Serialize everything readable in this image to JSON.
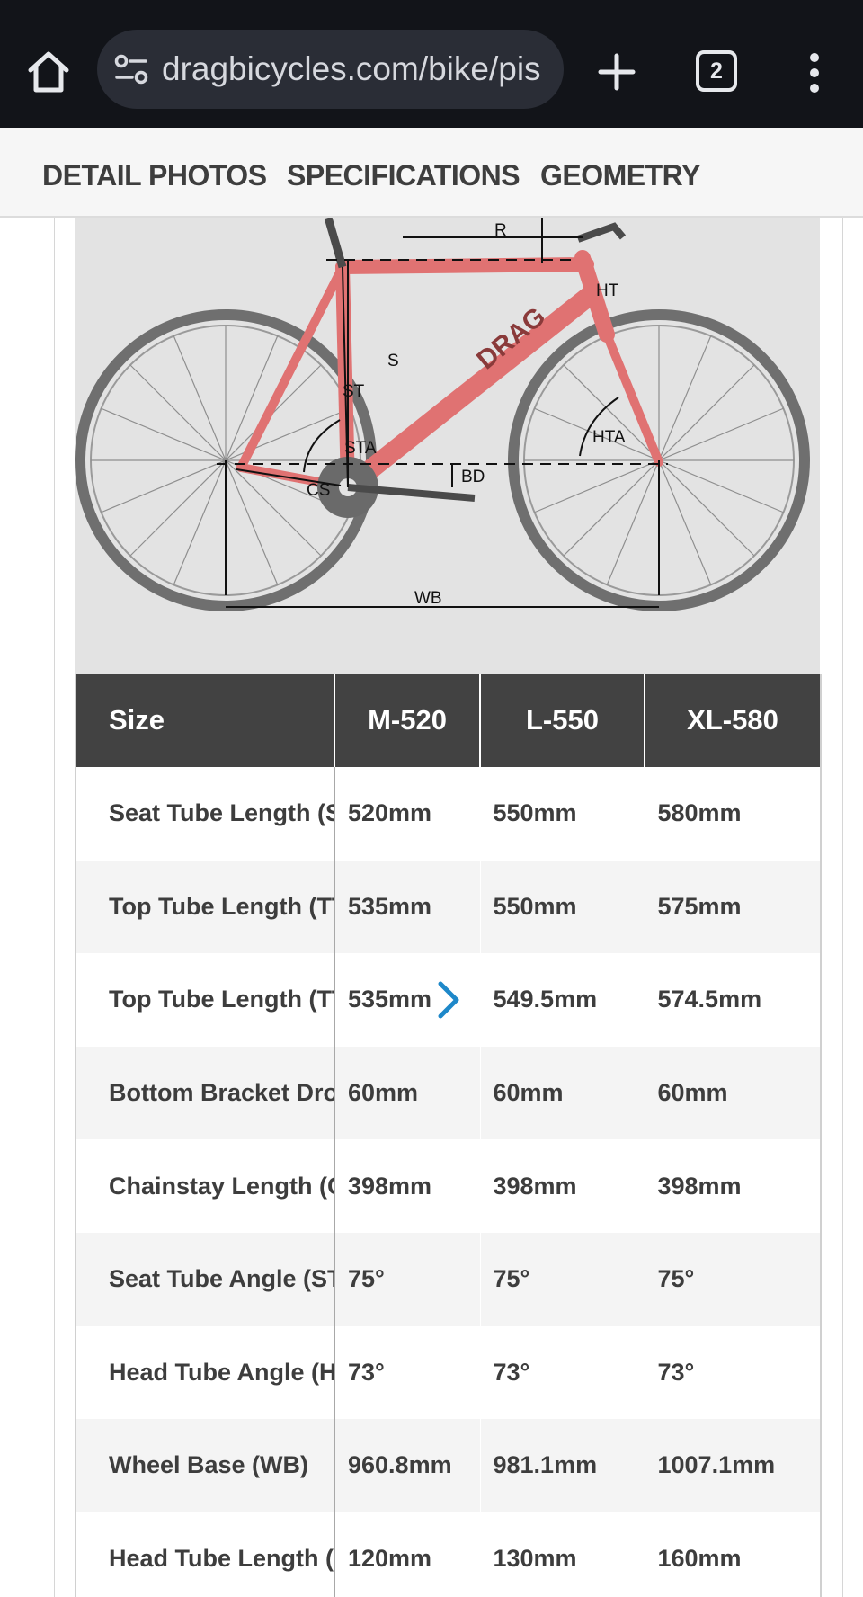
{
  "browser": {
    "url": "dragbicycles.com/bike/pis",
    "tab_count": "2",
    "icons": [
      "home-icon",
      "site-settings-icon",
      "plus-icon",
      "tab-switcher-icon",
      "more-vert-icon"
    ]
  },
  "section_tabs": [
    {
      "label": "DETAIL PHOTOS"
    },
    {
      "label": "SPECIFICATIONS"
    },
    {
      "label": "GEOMETRY"
    }
  ],
  "diagram": {
    "labels": {
      "r": "R",
      "ht": "HT",
      "s": "S",
      "st": "ST",
      "sta": "STA",
      "hta": "HTA",
      "bd": "BD",
      "cs": "CS",
      "wb": "WB",
      "frame_brand": "DRAG"
    },
    "colors": {
      "frame": "#e07272",
      "background": "#e3e3e3"
    }
  },
  "table": {
    "headers": [
      "Size",
      "M-520",
      "L-550",
      "XL-580"
    ],
    "rows": [
      {
        "label": "Seat Tube Length (ST)",
        "m": "520mm",
        "l": "550mm",
        "xl": "580mm"
      },
      {
        "label": "Top Tube Length (TT),",
        "m": "535mm",
        "l": "550mm",
        "xl": "575mm"
      },
      {
        "label": "Top Tube Length (TT),",
        "m": "535mm",
        "l": "549.5mm",
        "xl": "574.5mm"
      },
      {
        "label": "Bottom Bracket Drop (",
        "m": "60mm",
        "l": "60mm",
        "xl": "60mm"
      },
      {
        "label": "Chainstay Length (CS)",
        "m": "398mm",
        "l": "398mm",
        "xl": "398mm"
      },
      {
        "label": "Seat Tube Angle (STA)",
        "m": "75°",
        "l": "75°",
        "xl": "75°"
      },
      {
        "label": "Head Tube Angle (HTA",
        "m": "73°",
        "l": "73°",
        "xl": "73°"
      },
      {
        "label": "Wheel Base (WB)",
        "m": "960.8mm",
        "l": "981.1mm",
        "xl": "1007.1mm"
      },
      {
        "label": "Head Tube Length (HT",
        "m": "120mm",
        "l": "130mm",
        "xl": "160mm"
      }
    ]
  },
  "accent_color": "#1e88c9"
}
